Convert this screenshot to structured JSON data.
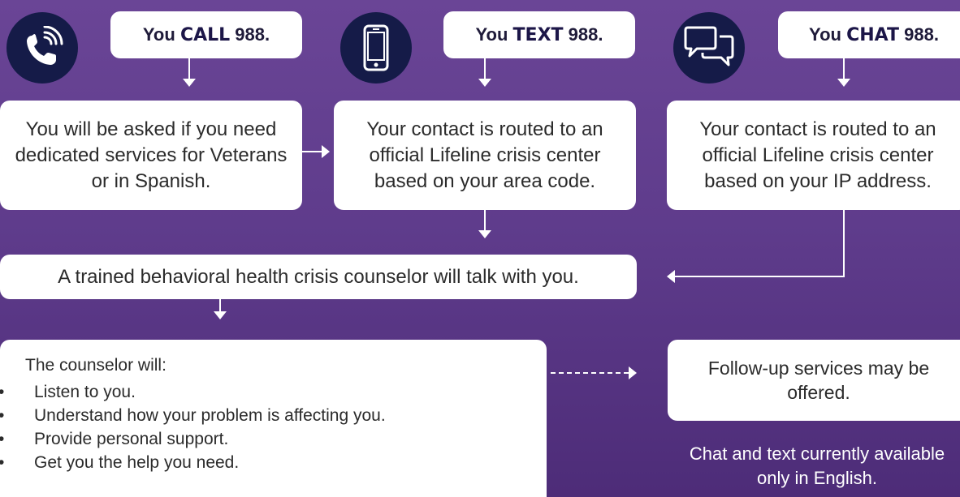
{
  "call_column": {
    "icon": "phone-icon",
    "pill_prefix": "You",
    "pill_keyword": "CALL",
    "pill_suffix": "988.",
    "step_text": "You will be asked if you need dedicated services for Veterans or in Spanish."
  },
  "text_column": {
    "icon": "smartphone-icon",
    "pill_prefix": "You",
    "pill_keyword": "TEXT",
    "pill_suffix": "988.",
    "step_text": "Your contact is routed to an official Lifeline crisis center based on your area code."
  },
  "chat_column": {
    "icon": "chat-bubbles-icon",
    "pill_prefix": "You",
    "pill_keyword": "CHAT",
    "pill_suffix": "988.",
    "step_text": "Your contact is routed to an official Lifeline crisis center based on your IP address."
  },
  "counselor_step": {
    "text": "A trained behavioral health crisis counselor will talk with you."
  },
  "counselor_will": {
    "heading": "The counselor will:",
    "bullet_glyph": "•",
    "items": [
      "Listen to you.",
      "Understand how your problem is affecting you.",
      "Provide personal support.",
      "Get you the help you need."
    ]
  },
  "follow_up": {
    "text": "Follow-up services may be offered."
  },
  "language_note": {
    "line1": "Chat and text currently available",
    "line2": "only in English."
  },
  "colors": {
    "background_top": "#6a4596",
    "background_bottom": "#4d2c78",
    "icon_circle": "#151b48",
    "box": "#ffffff"
  }
}
